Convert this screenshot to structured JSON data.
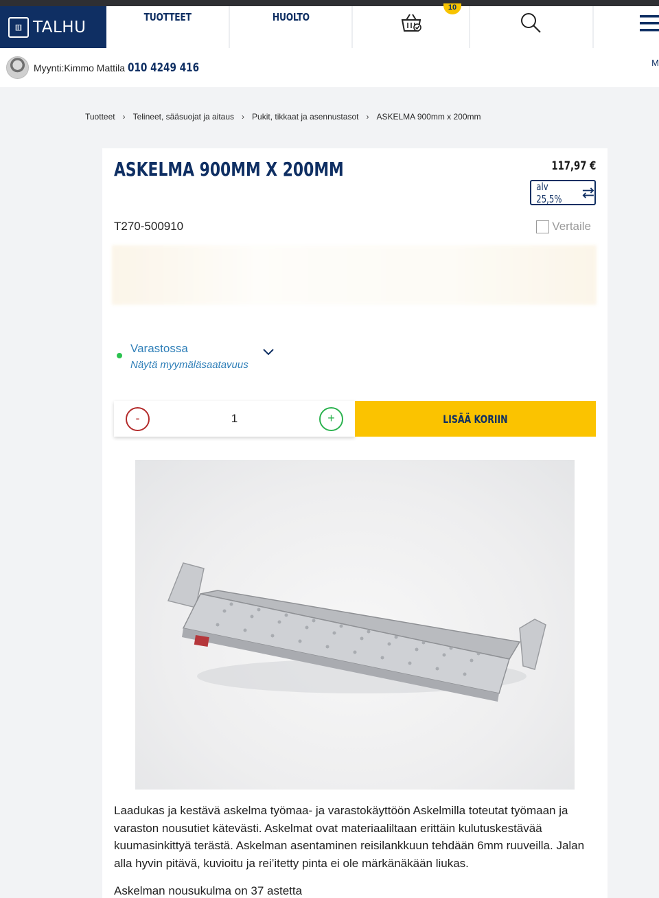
{
  "nav": {
    "logo_text": "TALHU",
    "items": [
      {
        "label": "TUOTTEET"
      },
      {
        "label": "HUOLTO"
      }
    ],
    "cart_count": "10",
    "colors": {
      "brand": "#0f2f63",
      "accent": "#fbc300"
    }
  },
  "seller": {
    "label": "Myynti:Kimmo Mattila",
    "phone": "010 4249 416",
    "edge_letter": "M"
  },
  "breadcrumb": [
    {
      "label": "Tuotteet"
    },
    {
      "label": "Telineet, sääsuojat ja aitaus"
    },
    {
      "label": "Pukit, tikkaat ja asennustasot"
    },
    {
      "label": "ASKELMA 900mm x 200mm"
    }
  ],
  "product": {
    "title": "ASKELMA 900MM X 200MM",
    "price": "117,97 €",
    "vat_label": "alv 25,5%",
    "sku": "T270-500910",
    "compare_label": "Vertaile",
    "stock_status": "Varastossa",
    "stock_link": "Näytä myymäläsaatavuus",
    "quantity": "1",
    "minus_symbol": "-",
    "plus_symbol": "+",
    "add_to_cart": "LISÄÄ KORIIN",
    "description": "Laadukas ja kestävä askelma työmaa- ja varastokäyttöön Askelmilla toteutat työmaan ja varaston nousutiet kätevästi. Askelmat ovat materiaaliltaan erittäin kulutuskestävää kuumasinkittyä terästä. Askelman asentaminen reisilankkuun tehdään 6mm ruuveilla. Jalan alla hyvin pitävä, kuvioitu ja rei’itetty pinta ei ole märkänäkään liukas.",
    "angle_text": "Askelman nousukulma on 37 astetta"
  }
}
